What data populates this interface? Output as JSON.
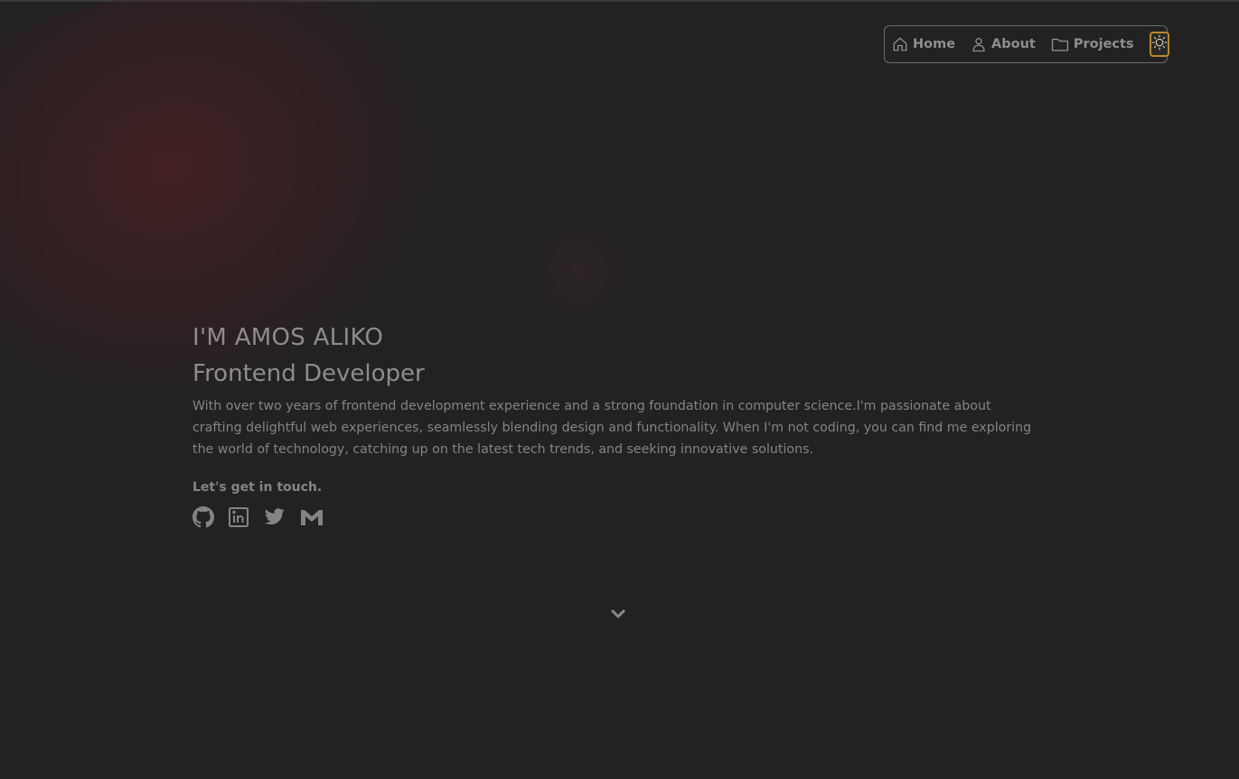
{
  "nav": {
    "items": [
      {
        "label": "Home",
        "icon": "home-icon"
      },
      {
        "label": "About",
        "icon": "user-icon"
      },
      {
        "label": "Projects",
        "icon": "folder-icon"
      }
    ],
    "theme_toggle_icon": "sun-icon"
  },
  "hero": {
    "name": "I'M AMOS ALIKO",
    "role": "Frontend Developer",
    "bio": "With over two years of frontend development experience and a strong foundation in computer science.I'm passionate about crafting delightful web experiences, seamlessly blending design and functionality. When I'm not coding, you can find me exploring the world of technology, catching up on the latest tech trends, and seeking innovative solutions.",
    "contact_heading": "Let's get in touch."
  },
  "socials": [
    {
      "icon": "github-icon"
    },
    {
      "icon": "linkedin-icon"
    },
    {
      "icon": "twitter-icon"
    },
    {
      "icon": "gmail-icon"
    }
  ],
  "scroll_icon": "chevron-down-icon",
  "colors": {
    "background": "#232223",
    "text": "#8e8c8d",
    "accent": "#b58a2d",
    "border": "#6b6a6b"
  }
}
